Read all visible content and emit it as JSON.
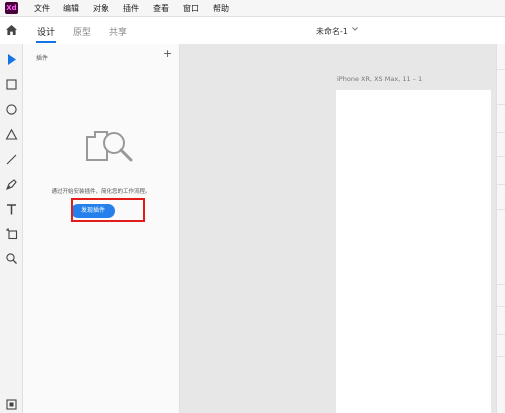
{
  "app": {
    "logo_text": "Xd"
  },
  "menu": [
    "文件",
    "编辑",
    "对象",
    "插件",
    "查看",
    "窗口",
    "帮助"
  ],
  "tabs": [
    {
      "label": "设计",
      "active": true
    },
    {
      "label": "原型",
      "active": false
    },
    {
      "label": "共享",
      "active": false
    }
  ],
  "document": {
    "title": "未命名-1"
  },
  "tools": [
    "select-icon",
    "rectangle-icon",
    "ellipse-icon",
    "polygon-icon",
    "line-icon",
    "pen-icon",
    "text-icon",
    "artboard-icon",
    "zoom-icon"
  ],
  "plugins_panel": {
    "title": "插件",
    "add_label": "+",
    "info_text": "通过开始安装插件，简化您的工作流程。",
    "discover_button": "发现插件"
  },
  "canvas": {
    "artboard_label": "iPhone XR, XS Max, 11 – 1"
  },
  "colors": {
    "accent": "#1473e6",
    "button": "#2680eb",
    "highlight": "#e21b1b",
    "logo_bg": "#470137",
    "logo_fg": "#ff61f6"
  }
}
